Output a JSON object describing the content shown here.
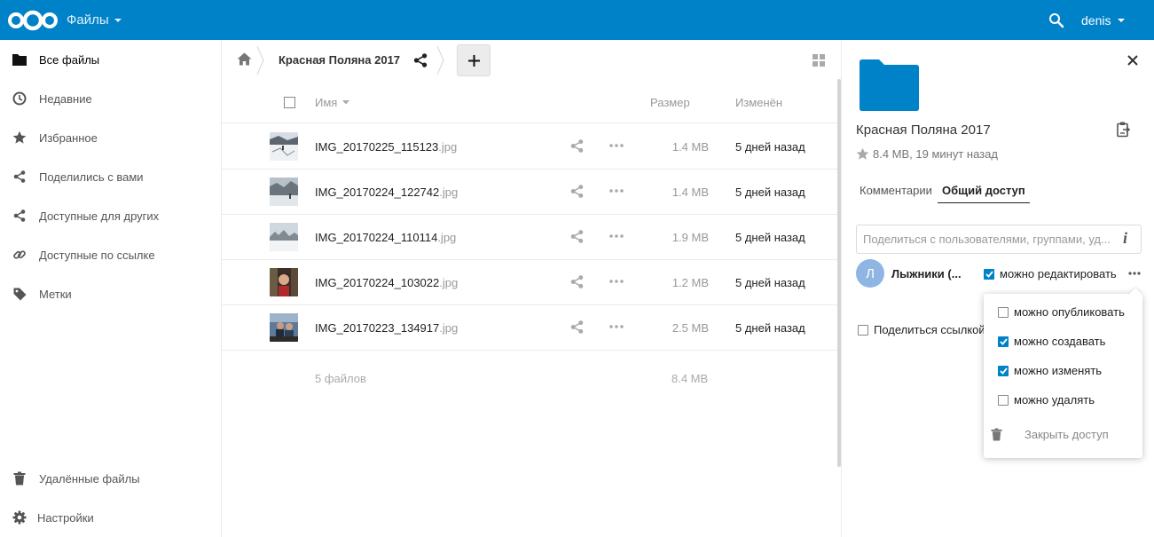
{
  "header": {
    "app_name": "Файлы",
    "user_name": "denis",
    "brand_color": "#0082c9",
    "icons": {
      "logo": "nextcloud-logo",
      "search": "search-icon",
      "dropdown": "caret-down-icon"
    }
  },
  "sidebar": {
    "items": [
      {
        "label": "Все файлы",
        "icon": "folder-icon",
        "active": true
      },
      {
        "label": "Недавние",
        "icon": "clock-icon"
      },
      {
        "label": "Избранное",
        "icon": "star-icon"
      },
      {
        "label": "Поделились с вами",
        "icon": "share-icon"
      },
      {
        "label": "Доступные для других",
        "icon": "share-icon"
      },
      {
        "label": "Доступные по ссылке",
        "icon": "link-icon"
      },
      {
        "label": "Метки",
        "icon": "tag-icon"
      }
    ],
    "bottom": [
      {
        "label": "Удалённые файлы",
        "icon": "trash-icon"
      },
      {
        "label": "Настройки",
        "icon": "gear-icon"
      }
    ]
  },
  "breadcrumb": {
    "folder": "Красная Поляна 2017"
  },
  "table": {
    "columns": {
      "name": "Имя",
      "size": "Размер",
      "modified": "Изменён"
    },
    "rows": [
      {
        "name": "IMG_20170225_115123",
        "ext": ".jpg",
        "size": "1.4 MB",
        "modified": "5 дней назад"
      },
      {
        "name": "IMG_20170224_122742",
        "ext": ".jpg",
        "size": "1.4 MB",
        "modified": "5 дней назад"
      },
      {
        "name": "IMG_20170224_110114",
        "ext": ".jpg",
        "size": "1.9 MB",
        "modified": "5 дней назад"
      },
      {
        "name": "IMG_20170224_103022",
        "ext": ".jpg",
        "size": "1.2 MB",
        "modified": "5 дней назад"
      },
      {
        "name": "IMG_20170223_134917",
        "ext": ".jpg",
        "size": "2.5 MB",
        "modified": "5 дней назад"
      }
    ],
    "summary": {
      "files": "5 файлов",
      "size": "8.4 MB"
    }
  },
  "details": {
    "title": "Красная Поляна 2017",
    "meta": "8.4 MB, 19 минут назад",
    "tabs": {
      "comments": "Комментарии",
      "sharing": "Общий доступ"
    },
    "share_input_placeholder": "Поделиться с пользователями, группами, уд...",
    "info_glyph": "i",
    "share": {
      "avatar_initial": "Л",
      "name": "Лыжники (...",
      "can_edit_label": "можно редактировать",
      "can_edit": true
    },
    "permissions": [
      {
        "label": "можно опубликовать",
        "checked": false
      },
      {
        "label": "можно создавать",
        "checked": true
      },
      {
        "label": "можно изменять",
        "checked": true
      },
      {
        "label": "можно удалять",
        "checked": false
      }
    ],
    "unshare_label": "Закрыть доступ",
    "link_share_label": "Поделиться ссылкой"
  }
}
